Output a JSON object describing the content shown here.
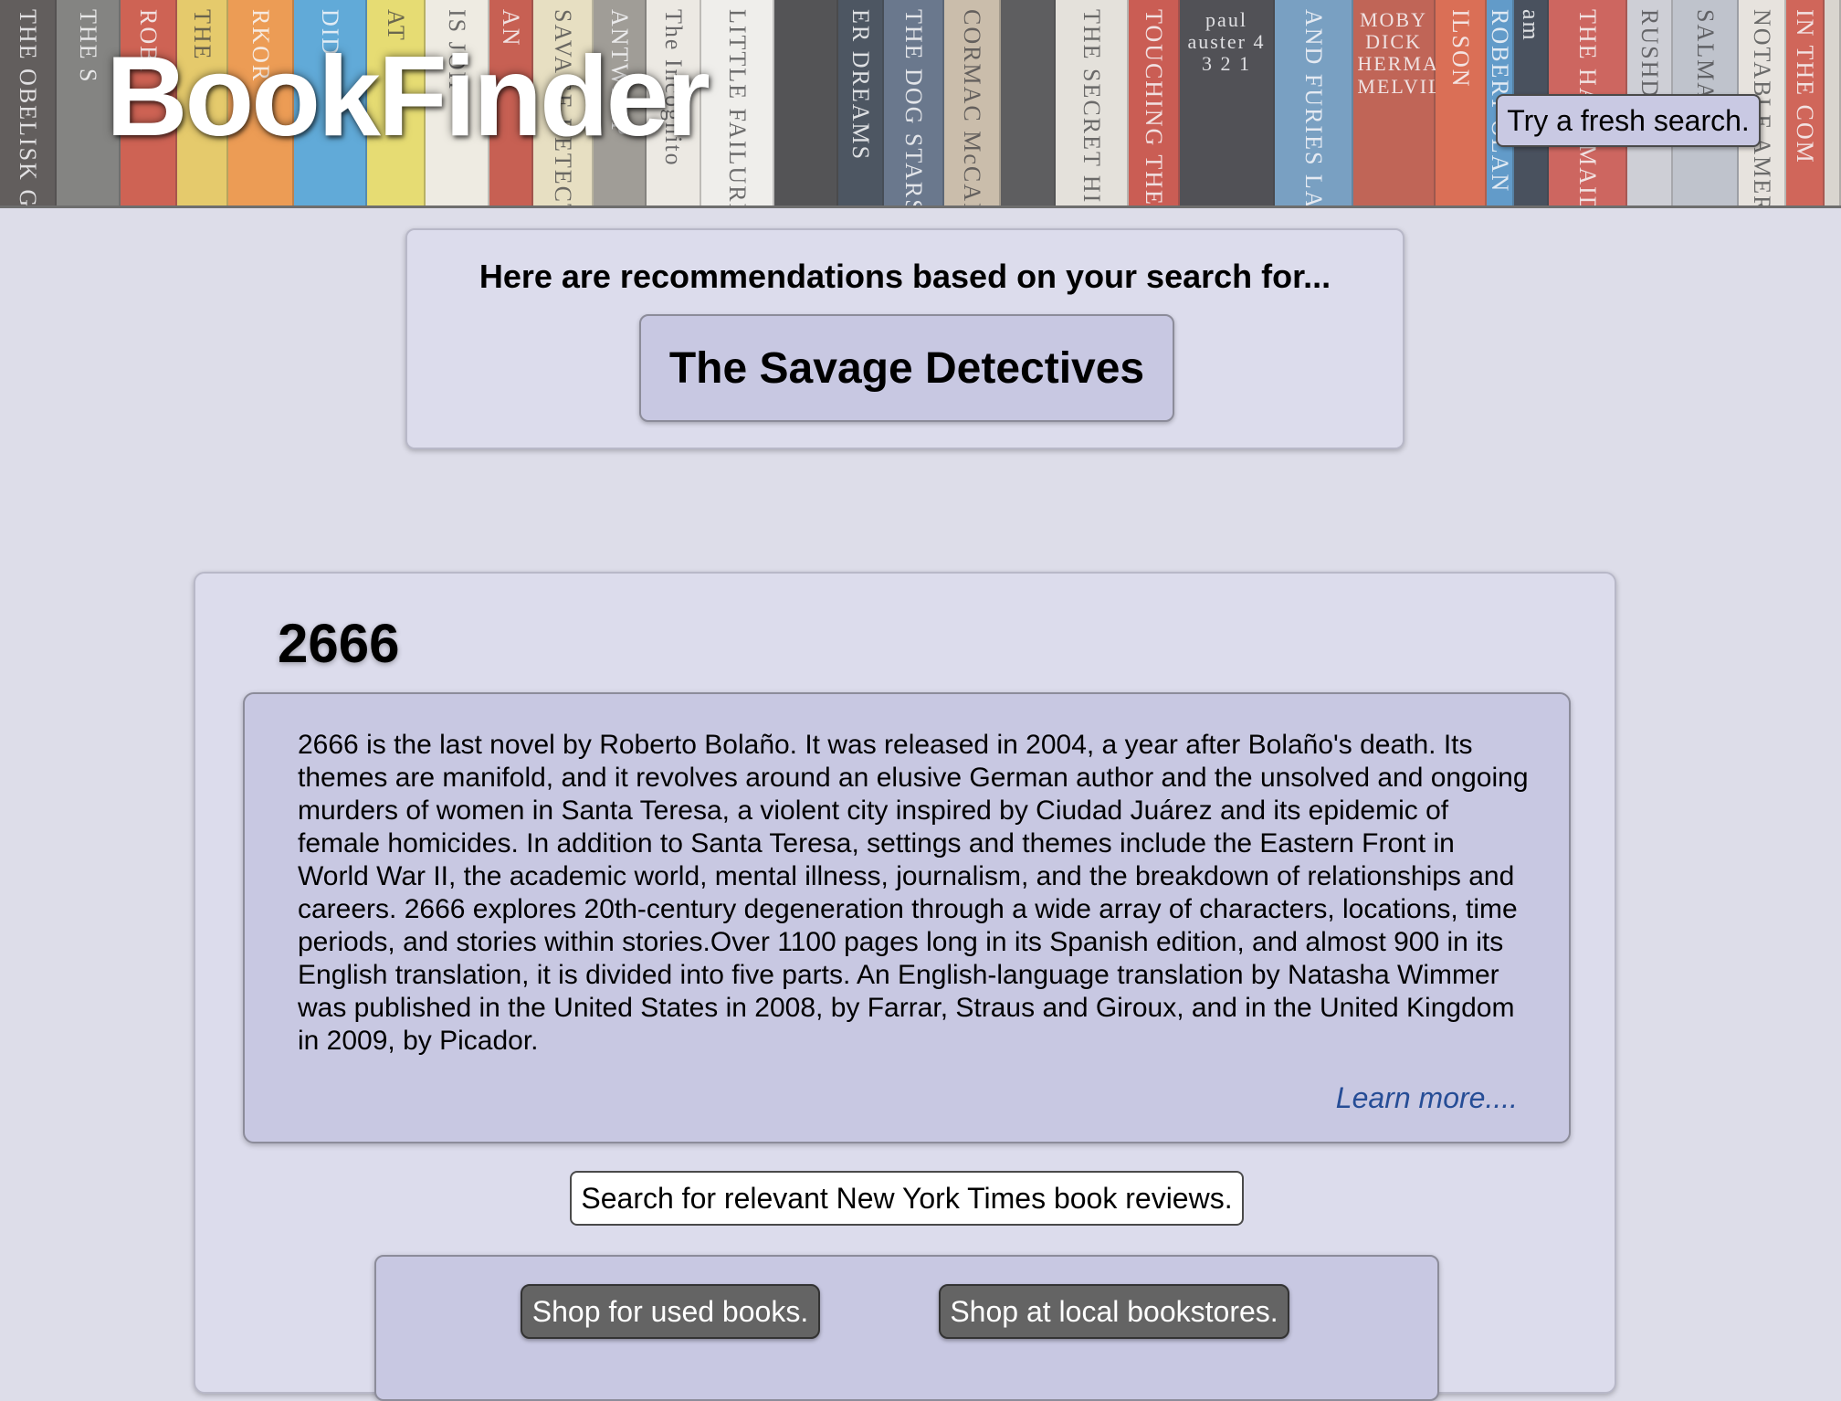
{
  "header": {
    "logo": "BookFinder",
    "fresh_search_label": "Try a fresh search.",
    "spines": [
      {
        "text": "THE OBELISK GA",
        "color": "#3f3a36",
        "dark": false
      },
      {
        "text": "THE S",
        "color": "#6b6b66",
        "dark": false
      },
      {
        "text": "ROBI",
        "color": "#c9402b",
        "dark": false
      },
      {
        "text": "THE",
        "color": "#e7c54a",
        "dark": true
      },
      {
        "text": "RKOR",
        "color": "#f08a2c",
        "dark": false
      },
      {
        "text": "DID",
        "color": "#3e9bd4",
        "dark": false
      },
      {
        "text": "AT",
        "color": "#e8dc52",
        "dark": true
      },
      {
        "text": "IS JOH",
        "color": "#f2efe0",
        "dark": true
      },
      {
        "text": "AN",
        "color": "#c03d2a",
        "dark": false
      },
      {
        "text": "SAVAGE DETECTIVES",
        "color": "#e9dfb8",
        "dark": true
      },
      {
        "text": "ANTWERP",
        "color": "#8f8b80",
        "dark": false
      },
      {
        "text": "The Incognito",
        "color": "#f0ece2",
        "dark": true
      },
      {
        "text": "LITTLE FAILURE",
        "color": "#f4f2ec",
        "dark": true
      },
      {
        "text": "",
        "color": "#2d2d2d",
        "dark": false
      },
      {
        "text": "ER DREAMS",
        "color": "#24303d",
        "dark": false
      },
      {
        "text": "THE DOG STARS",
        "color": "#4a5c74",
        "dark": false
      },
      {
        "text": "CORMAC McCARTHY",
        "color": "#c5b49a",
        "dark": true
      },
      {
        "text": "",
        "color": "#3a3a3a",
        "dark": false
      },
      {
        "text": "THE SECRET HISTORY",
        "color": "#e6e2d8",
        "dark": true
      },
      {
        "text": "TOUCHING THE VOID",
        "color": "#c5392b",
        "dark": false
      },
      {
        "text": "paul auster 4 3 2 1",
        "color": "#2a2a2e",
        "dark": false,
        "horiz": true
      },
      {
        "text": "AND FURIES LA",
        "color": "#5d8fb8",
        "dark": false
      },
      {
        "text": "MOBY DICK HERMAN MELVILLE",
        "color": "#b8432f",
        "dark": false,
        "horiz": true
      },
      {
        "text": "ILSON",
        "color": "#d9502e",
        "dark": false
      },
      {
        "text": "ROBERT OLAN",
        "color": "#3f88c0",
        "dark": false
      },
      {
        "text": "am",
        "color": "#1f2a38",
        "dark": false
      },
      {
        "text": "THE HANDMAID'S TALE",
        "color": "#c8453a",
        "dark": false
      },
      {
        "text": "RUSHDIE",
        "color": "#c9cbd1",
        "dark": true
      },
      {
        "text": "SALMAN",
        "color": "#b7bcc4",
        "dark": true
      },
      {
        "text": "NOTABLE AMERICAN WOME",
        "color": "#e9e5dc",
        "dark": true
      },
      {
        "text": "IN THE COM",
        "color": "#cc4433",
        "dark": false
      }
    ]
  },
  "search_summary": {
    "heading": "Here are recommendations based on your search for...",
    "query": "The Savage Detectives"
  },
  "result": {
    "title": "2666",
    "description": "2666 is the last novel by Roberto Bolaño. It was released in 2004, a year after Bolaño's death. Its themes are manifold, and it revolves around an elusive German author and the unsolved and ongoing murders of women in Santa Teresa, a violent city inspired by Ciudad Juárez and its epidemic of female homicides. In addition to Santa Teresa, settings and themes include the Eastern Front in World War II, the academic world, mental illness, journalism, and the breakdown of relationships and careers. 2666 explores 20th-century degeneration through a wide array of characters, locations, time periods, and stories within stories.Over 1100 pages long in its Spanish edition, and almost 900 in its English translation, it is divided into five parts. An English-language translation by Natasha Wimmer was published in the United States in 2008, by Farrar, Straus and Giroux, and in the United Kingdom in 2009, by Picador.",
    "learn_more": "Learn more....",
    "nyt_button": "Search for relevant New York Times book reviews.",
    "shop_used": "Shop for used books.",
    "shop_local": "Shop at local bookstores."
  }
}
